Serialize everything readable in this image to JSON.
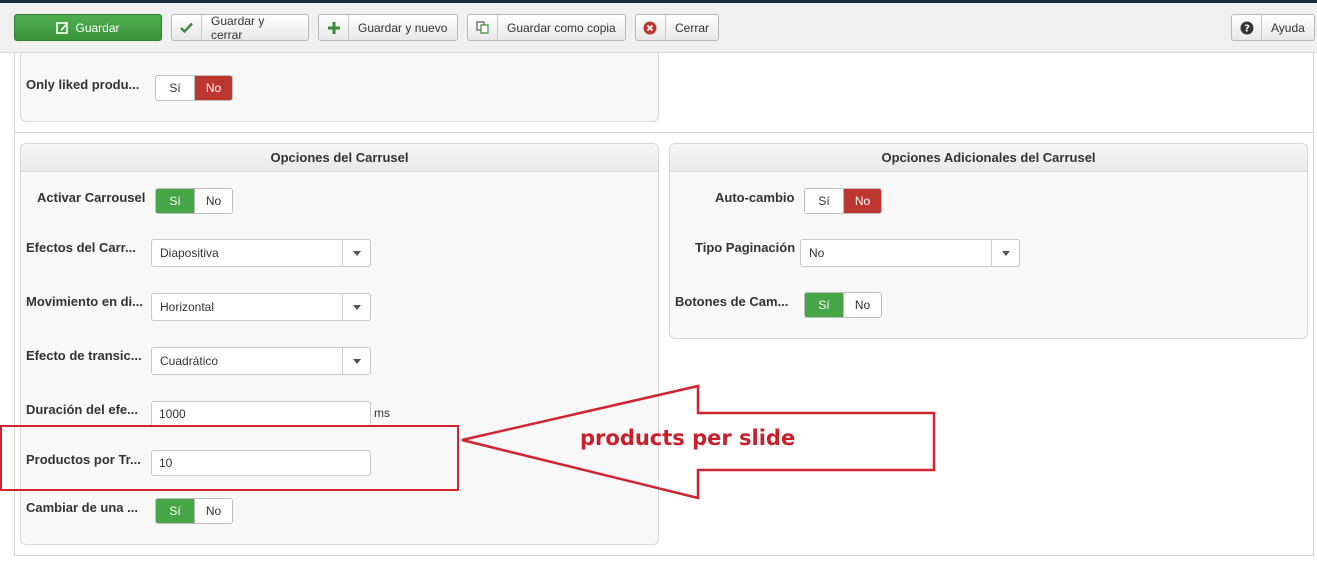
{
  "toolbar": {
    "save": "Guardar",
    "save_close": "Guardar y cerrar",
    "save_new": "Guardar y nuevo",
    "save_copy": "Guardar como copia",
    "close": "Cerrar",
    "help": "Ayuda"
  },
  "top_panel": {
    "only_liked_label": "Only liked produ...",
    "only_liked_yes": "Sí",
    "only_liked_no": "No",
    "only_liked_value": "No"
  },
  "carousel": {
    "title": "Opciones del Carrusel",
    "activate_label": "Activar Carrousel",
    "activate_yes": "Sí",
    "activate_no": "No",
    "activate_value": "Sí",
    "effects_label": "Efectos del Carr...",
    "effects_value": "Diapositiva",
    "movement_label": "Movimiento en di...",
    "movement_value": "Horizontal",
    "transition_label": "Efecto de transic...",
    "transition_value": "Cuadrático",
    "duration_label": "Duración del efe...",
    "duration_value": "1000",
    "duration_unit": "ms",
    "products_label": "Productos por Tr...",
    "products_value": "10",
    "change_label": "Cambiar de una ...",
    "change_yes": "Sí",
    "change_no": "No",
    "change_value": "Sí"
  },
  "additional": {
    "title": "Opciones Adicionales del Carrusel",
    "autochange_label": "Auto-cambio",
    "autochange_yes": "Sí",
    "autochange_no": "No",
    "autochange_value": "No",
    "pagination_label": "Tipo Paginación",
    "pagination_value": "No",
    "buttons_label": "Botones de Cam...",
    "buttons_yes": "Sí",
    "buttons_no": "No",
    "buttons_value": "Sí"
  },
  "annotation": {
    "text": "products per slide",
    "color": "#d1242f"
  },
  "colors": {
    "green": "#46a546",
    "red": "#bd362f",
    "save_button": "#41a041"
  }
}
